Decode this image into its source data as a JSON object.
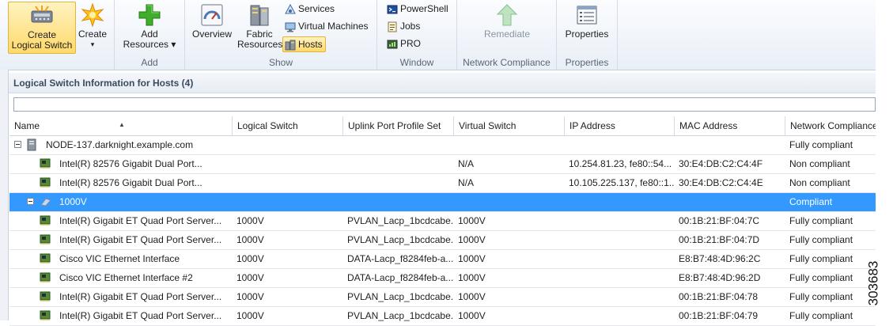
{
  "ribbon": {
    "groups": {
      "add": "Add",
      "show": "Show",
      "window": "Window",
      "network_compliance": "Network Compliance",
      "properties": "Properties"
    },
    "buttons": {
      "create_logical_switch_line1": "Create",
      "create_logical_switch_line2": "Logical Switch",
      "create_line1": "Create",
      "create_arrow": "▾",
      "add_resources_line1": "Add",
      "add_resources_line2": "Resources ▾",
      "overview": "Overview",
      "fabric_resources_line1": "Fabric",
      "fabric_resources_line2": "Resources",
      "services": "Services",
      "virtual_machines": "Virtual Machines",
      "hosts": "Hosts",
      "powershell": "PowerShell",
      "jobs": "Jobs",
      "pro": "PRO",
      "remediate": "Remediate",
      "properties": "Properties"
    }
  },
  "panel": {
    "title": "Logical Switch Information for Hosts (4)",
    "search_placeholder": ""
  },
  "table": {
    "columns": [
      "Name",
      "Logical Switch",
      "Uplink Port Profile Set",
      "Virtual Switch",
      "IP Address",
      "MAC Address",
      "Network Compliance"
    ],
    "rows": [
      {
        "level": 0,
        "kind": "host",
        "expand": true,
        "name": "NODE-137.darknight.example.com",
        "logical_switch": "",
        "uplink": "",
        "virtual_switch": "",
        "ip": "",
        "mac": "",
        "compliance": "Fully compliant"
      },
      {
        "level": 1,
        "kind": "nic",
        "name": "Intel(R) 82576 Gigabit Dual Port...",
        "logical_switch": "",
        "uplink": "",
        "virtual_switch": "N/A",
        "ip": "10.254.81.23, fe80::54...",
        "mac": "30:E4:DB:C2:C4:4F",
        "compliance": "Non compliant"
      },
      {
        "level": 1,
        "kind": "nic",
        "name": "Intel(R) 82576 Gigabit Dual Port...",
        "logical_switch": "",
        "uplink": "",
        "virtual_switch": "N/A",
        "ip": "10.105.225.137, fe80::1...",
        "mac": "30:E4:DB:C2:C4:4E",
        "compliance": "Non compliant"
      },
      {
        "level": 1,
        "kind": "switch",
        "expand": true,
        "selected": true,
        "name": "1000V",
        "logical_switch": "",
        "uplink": "",
        "virtual_switch": "",
        "ip": "",
        "mac": "",
        "compliance": "Compliant"
      },
      {
        "level": 1,
        "kind": "nic",
        "name": "Intel(R) Gigabit ET Quad Port Server...",
        "logical_switch": "1000V",
        "uplink": "PVLAN_Lacp_1bcdcabe...",
        "virtual_switch": "1000V",
        "ip": "",
        "mac": "00:1B:21:BF:04:7C",
        "compliance": "Fully compliant"
      },
      {
        "level": 1,
        "kind": "nic",
        "name": "Intel(R) Gigabit ET Quad Port Server...",
        "logical_switch": "1000V",
        "uplink": "PVLAN_Lacp_1bcdcabe...",
        "virtual_switch": "1000V",
        "ip": "",
        "mac": "00:1B:21:BF:04:7D",
        "compliance": "Fully compliant"
      },
      {
        "level": 1,
        "kind": "nic",
        "name": "Cisco VIC Ethernet Interface",
        "logical_switch": "1000V",
        "uplink": "DATA-Lacp_f8284feb-a...",
        "virtual_switch": "1000V",
        "ip": "",
        "mac": "E8:B7:48:4D:96:2C",
        "compliance": "Fully compliant"
      },
      {
        "level": 1,
        "kind": "nic",
        "name": "Cisco VIC Ethernet Interface #2",
        "logical_switch": "1000V",
        "uplink": "DATA-Lacp_f8284feb-a...",
        "virtual_switch": "1000V",
        "ip": "",
        "mac": "E8:B7:48:4D:96:2D",
        "compliance": "Fully compliant"
      },
      {
        "level": 1,
        "kind": "nic",
        "name": "Intel(R) Gigabit ET Quad Port Server...",
        "logical_switch": "1000V",
        "uplink": "PVLAN_Lacp_1bcdcabe...",
        "virtual_switch": "1000V",
        "ip": "",
        "mac": "00:1B:21:BF:04:78",
        "compliance": "Fully compliant"
      },
      {
        "level": 1,
        "kind": "nic",
        "name": "Intel(R) Gigabit ET Quad Port Server...",
        "logical_switch": "1000V",
        "uplink": "PVLAN_Lacp_1bcdcabe...",
        "virtual_switch": "1000V",
        "ip": "",
        "mac": "00:1B:21:BF:04:79",
        "compliance": "Fully compliant"
      }
    ]
  },
  "figure_number": "303683",
  "colors": {
    "selection": "#3399ff",
    "ribbon_selected": "#ffd96a",
    "add_icon": "#3fae2a"
  },
  "icons": {
    "logical_switch": "switch-device-icon",
    "create": "starburst-icon",
    "add_resources": "green-plus-icon",
    "overview": "gauge-icon",
    "fabric_resources": "server-rack-icon",
    "services": "services-icon",
    "virtual_machines": "monitor-icon",
    "hosts": "hosts-icon",
    "powershell": "powershell-icon",
    "jobs": "jobs-icon",
    "pro": "pro-icon",
    "remediate": "up-arrow-icon",
    "properties": "properties-window-icon"
  }
}
